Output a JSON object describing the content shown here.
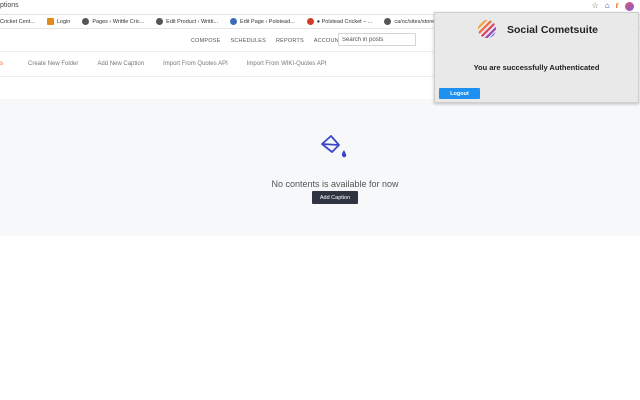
{
  "browser": {
    "url_fragment": "ptions",
    "bookmarks": [
      {
        "label": "Cricket Cent...",
        "icon": "none"
      },
      {
        "label": "Login",
        "icon": "orange"
      },
      {
        "label": "Pages ‹ Writtle Cric...",
        "icon": "dark"
      },
      {
        "label": "Edit Product ‹ Writti...",
        "icon": "dark"
      },
      {
        "label": "Edit Page ‹ Polstead...",
        "icon": "blue"
      },
      {
        "label": "● Polstead Cricket – ...",
        "icon": "red"
      },
      {
        "label": "ca/oc/sites/store",
        "icon": "dark"
      }
    ]
  },
  "nav": {
    "links": [
      "COMPOSE",
      "SCHEDULES",
      "REPORTS",
      "ACCOUNTS"
    ],
    "search_placeholder": "Search in posts"
  },
  "tabs": {
    "active": "s",
    "items": [
      "Create New Folder",
      "Add New Caption",
      "Import From Quotes API",
      "Import From WIKI-Quotes API"
    ]
  },
  "empty_state": {
    "message": "No contents is available for now",
    "button": "Add Caption",
    "accent_color": "#3b47c9"
  },
  "popup": {
    "title": "Social Cometsuite",
    "message": "You are successfully Authenticated",
    "logout_label": "Logout",
    "button_color": "#1e90f0"
  }
}
